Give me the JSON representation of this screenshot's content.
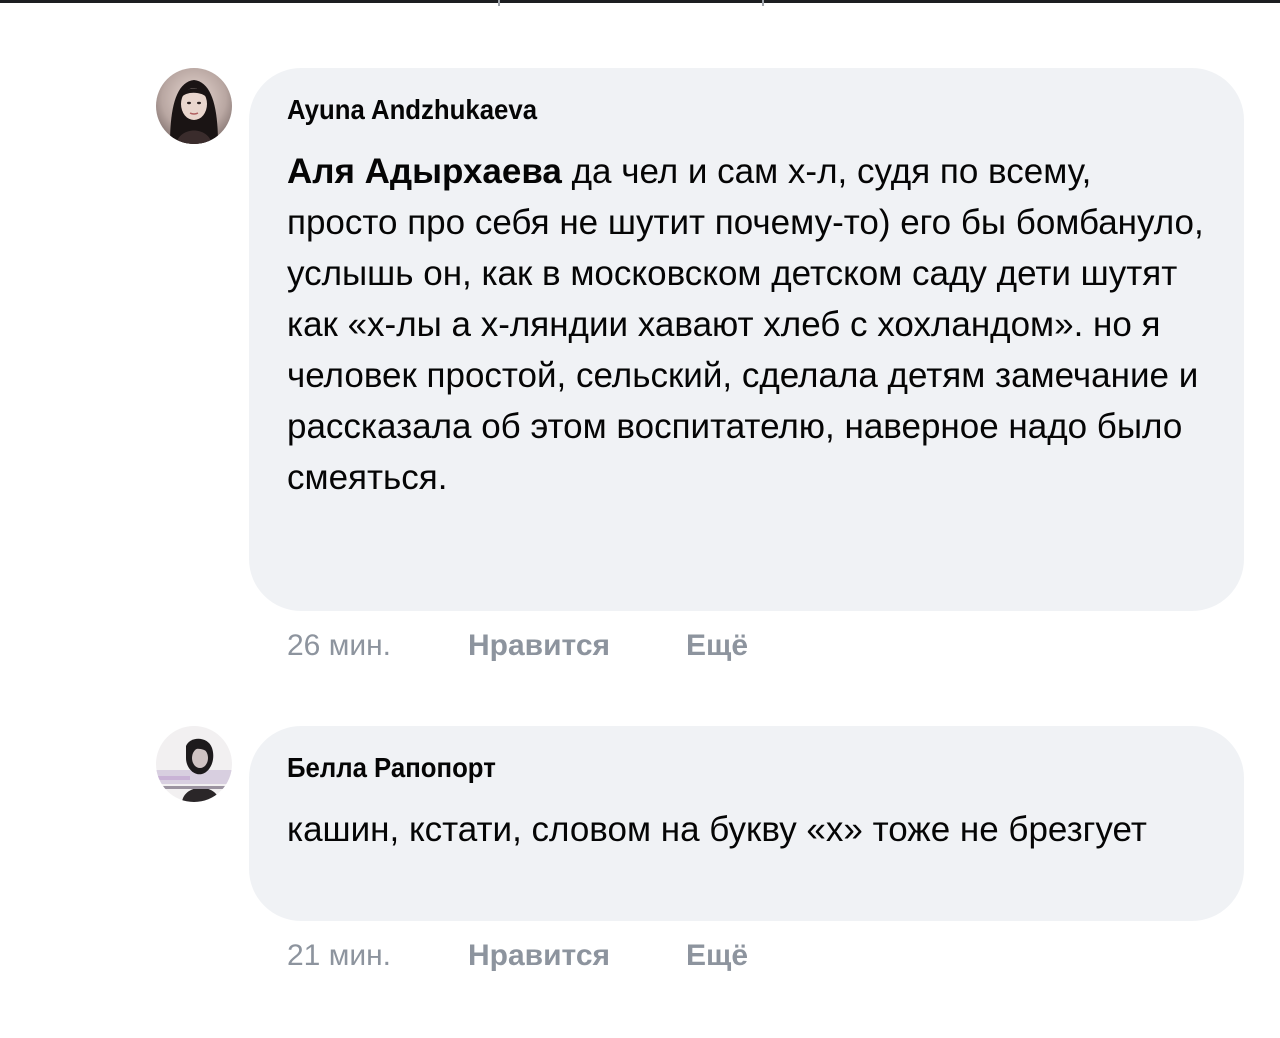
{
  "comments": [
    {
      "author": "Ayuna Andzhukaeva",
      "mention": "Аля Адырхаева",
      "text": "да чел и сам х-л, судя по всему, просто про себя не шутит почему-то) его бы бомбануло, услышь он, как в московском детском саду дети шутят как «х-лы а х-ляндии хавают хлеб с хохландом». но я человек простой, сельский, сделала детям замечание и рассказала об этом воспитателю, наверное надо было смеяться.",
      "time": "26 мин.",
      "like_label": "Нравится",
      "more_label": "Ещё"
    },
    {
      "author": "Белла Рапопорт",
      "text": "кашин, кстати, словом на букву «х» тоже не брезгует",
      "time": "21 мин.",
      "like_label": "Нравится",
      "more_label": "Ещё"
    }
  ],
  "colors": {
    "bubble": "#f0f2f5",
    "meta_text": "#8d949e",
    "body_text": "#050505"
  }
}
